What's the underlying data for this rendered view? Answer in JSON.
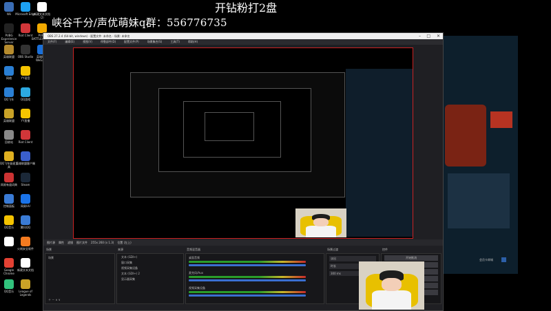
{
  "overlay": {
    "title": "开钻粉打2盘",
    "group_line": "峡谷千分/声优萌妹q群：556776735"
  },
  "desktop_icons": [
    {
      "label": "Wii",
      "color": "#3a6db5"
    },
    {
      "label": "PUBG Experience Server",
      "color": "#222"
    },
    {
      "label": "英雄联盟",
      "color": "#b58b2e"
    },
    {
      "label": "网络",
      "color": "#2a7fd4"
    },
    {
      "label": "QQ飞车",
      "color": "#2a7fd4"
    },
    {
      "label": "英雄联盟",
      "color": "#c9a227"
    },
    {
      "label": "回收站",
      "color": "#888"
    },
    {
      "label": "QQ飞车极速工具",
      "color": "#e0b020"
    },
    {
      "label": "网易有道词典",
      "color": "#c33"
    },
    {
      "label": "控制面板",
      "color": "#3a7bd5"
    },
    {
      "label": "QQ音乐",
      "color": "#f4c300"
    },
    {
      "label": "",
      "color": "#fff"
    },
    {
      "label": "Google Chrome",
      "color": "#e34133"
    },
    {
      "label": "QQ音乐",
      "color": "#31c27c"
    },
    {
      "label": "Microsoft Edge",
      "color": "#1da1f2"
    },
    {
      "label": "Riot Client",
      "color": "#d13639"
    },
    {
      "label": "OBS Studio",
      "color": "#333"
    },
    {
      "label": "YY语音",
      "color": "#f5c400"
    },
    {
      "label": "QQ游戏",
      "color": "#2ca9e1"
    },
    {
      "label": "YY直播",
      "color": "#f5c400"
    },
    {
      "label": "Riot Client",
      "color": "#d13639"
    },
    {
      "label": "英雄联盟客户端",
      "color": "#3a5fcd"
    },
    {
      "label": "Steam",
      "color": "#1b2838"
    },
    {
      "label": "网易UU",
      "color": "#1a73e8"
    },
    {
      "label": "腾讯QQ",
      "color": "#3a7bd5"
    },
    {
      "label": "火绒安全软件",
      "color": "#f47b20"
    },
    {
      "label": "新建文本文档",
      "color": "#fff"
    },
    {
      "label": "League of Legends",
      "color": "#c9a227"
    },
    {
      "label": "新建文本文档（2）",
      "color": "#fff"
    },
    {
      "label": "PUBG BATTLEGROUNDS",
      "color": "#f2a900"
    },
    {
      "label": "英雄联盟WeGame",
      "color": "#1a6fd8"
    }
  ],
  "obs": {
    "titlebar": "OBS 27.2.4 (64-bit, windows) - 配置文件: 未命名 - 场景: 未命名",
    "menu": [
      "文件(F)",
      "编辑(E)",
      "视图(V)",
      "停靠部件(D)",
      "配置文件(P)",
      "场景集合(S)",
      "工具(T)",
      "帮助(H)"
    ],
    "dock_row": [
      "图片源",
      "属性",
      "滤镜",
      "图片文件",
      "255x 260 (x 1.3)",
      "位置 (左上)"
    ],
    "headers": [
      "场景",
      "来源",
      "音频混音器",
      "场景过渡",
      "控件"
    ],
    "scenes": [
      "场景"
    ],
    "sources": [
      "文本 (GDI+)",
      "窗口采集",
      "视频采集设备",
      "文本 (GDI+) 2",
      "显示器采集"
    ],
    "mixer": [
      "桌面音频",
      "麦克风/Aux",
      "视频采集设备"
    ],
    "transition": [
      "淡出",
      "时长",
      "300 ms"
    ],
    "controls": [
      "开始推流",
      "开始录制",
      "启动虚拟摄像机",
      "工作室模式",
      "设置",
      "退出"
    ],
    "status": "LIVE: 00:00:00  REC: 00:00:00  CPU: 4.2%, 60.00 fps"
  },
  "game_panel": {
    "button": "会员卡商城"
  }
}
